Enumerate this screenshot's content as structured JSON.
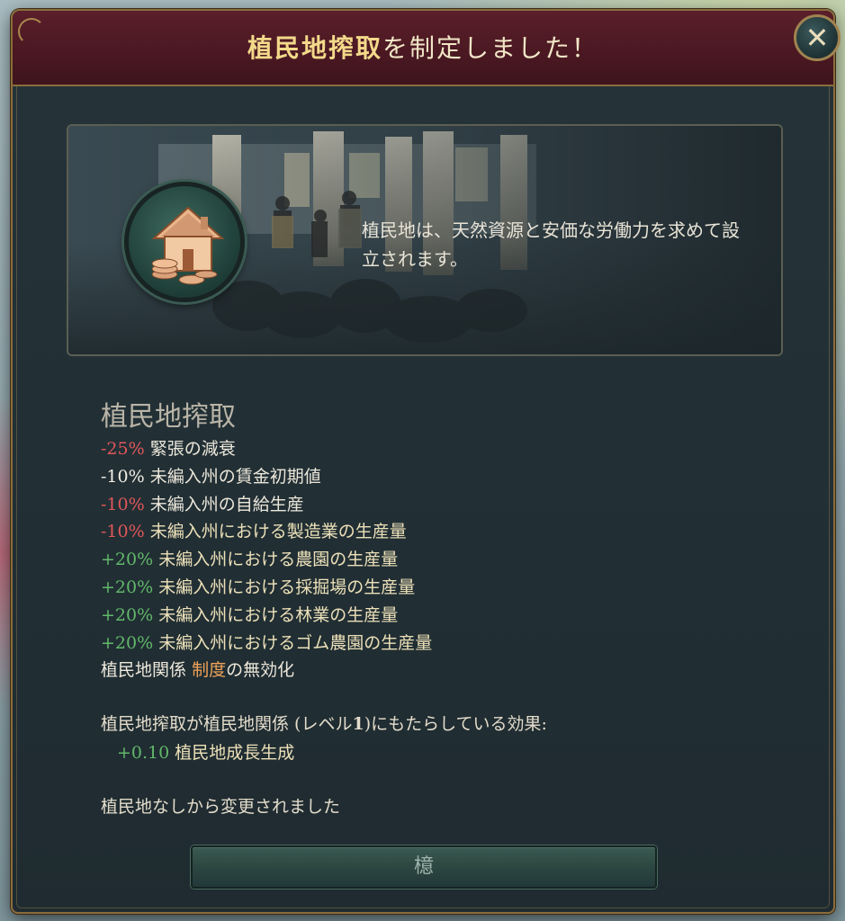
{
  "window": {
    "title_highlight": "植民地搾取",
    "title_rest": "を制定しました！",
    "close_glyph": "✕"
  },
  "banner": {
    "description": "植民地は、天然資源と安価な労働力を求めて設立されます。",
    "emblem_icon": "colony-house-coins-icon"
  },
  "effects": {
    "title": "植民地搾取",
    "lines": [
      {
        "value": "-25%",
        "tone": "neg",
        "text": "緊張の減衰"
      },
      {
        "value": "-10%",
        "tone": "neutral",
        "text": "未編入州の賃金初期値"
      },
      {
        "value": "-10%",
        "tone": "neg",
        "text": "未編入州の自給生産"
      },
      {
        "value": "-10%",
        "tone": "neg",
        "text": "未編入州における製造業の生産量"
      },
      {
        "value": "+20%",
        "tone": "pos",
        "text": "未編入州における農園の生産量"
      },
      {
        "value": "+20%",
        "tone": "pos",
        "text": "未編入州における採掘場の生産量"
      },
      {
        "value": "+20%",
        "tone": "pos",
        "text": "未編入州における林業の生産量"
      },
      {
        "value": "+20%",
        "tone": "pos",
        "text": "未編入州におけるゴム農園の生産量"
      }
    ],
    "disable_prefix": "植民地関係",
    "disable_institution": "制度",
    "disable_suffix": "の無効化"
  },
  "institution_effect": {
    "heading_pre": "植民地搾取が植民地関係 (レベル",
    "level": "1",
    "heading_post": ")にもたらしている効果:",
    "value": "+0.10",
    "text": "植民地成長生成"
  },
  "changed_from": "植民地なしから変更されました",
  "confirm_button": "檍",
  "colors": {
    "negative": "#e0565a",
    "positive": "#62b86a",
    "institution": "#f0a35a",
    "header": "#4a1822",
    "frame_gold": "#8a6c3c"
  }
}
